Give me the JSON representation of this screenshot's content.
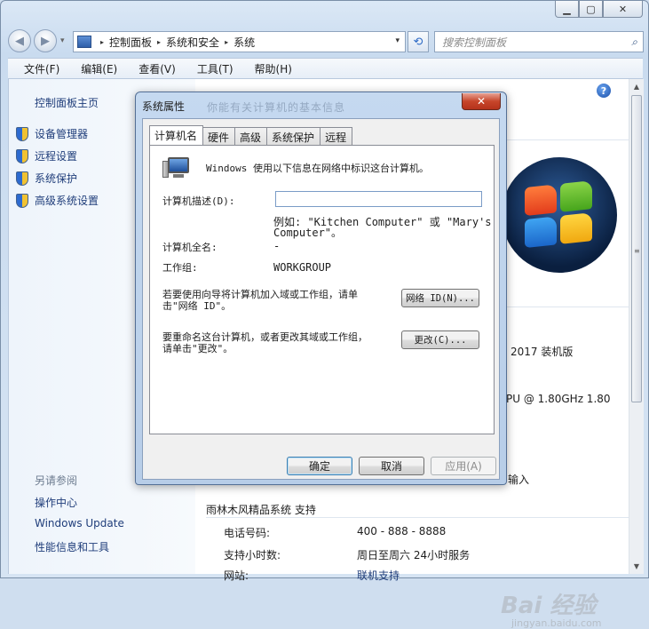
{
  "window": {
    "caption": {
      "minimize": "▁",
      "maximize": "▢",
      "close": "✕"
    }
  },
  "nav": {
    "back": "◀",
    "forward": "▶",
    "dropdown": "▾",
    "breadcrumb": [
      "控制面板",
      "系统和安全",
      "系统"
    ],
    "breadcrumb_sep": "▸",
    "address_dropdown": "▾",
    "refresh": "⟲",
    "search_placeholder": "搜索控制面板",
    "search_icon": "⌕"
  },
  "menubar": [
    "文件(F)",
    "编辑(E)",
    "查看(V)",
    "工具(T)",
    "帮助(H)"
  ],
  "left_pane": {
    "home": "控制面板主页",
    "items": [
      "设备管理器",
      "远程设置",
      "系统保护",
      "高级系统设置"
    ],
    "see_also": "另请参阅",
    "links": [
      "操作中心",
      "Windows Update",
      "性能信息和工具"
    ]
  },
  "right_pane": {
    "help": "?",
    "edition_partial": "2017 装机版",
    "cpu_partial": "PU @ 1.80GHz   1.80",
    "input_partial": "输入",
    "support_heading": "雨林木风精品系统 支持",
    "support_rows": [
      {
        "label": "电话号码:",
        "value": "400 - 888 - 8888"
      },
      {
        "label": "支持小时数:",
        "value": "周日至周六  24小时服务"
      },
      {
        "label": "网站:",
        "value": "联机支持"
      }
    ]
  },
  "scrollbar": {
    "up": "▲",
    "down": "▼",
    "grip": "≡"
  },
  "watermark": {
    "main": "Bai 经验",
    "sub": "jingyan.baidu.com"
  },
  "dialog": {
    "title": "系统属性",
    "ghost_title": "你能有关计算机的基本信息",
    "close": "✕",
    "tabs": [
      "计算机名",
      "硬件",
      "高级",
      "系统保护",
      "远程"
    ],
    "active_tab": 0,
    "intro": "Windows 使用以下信息在网络中标识这台计算机。",
    "desc_label": "计算机描述(D):",
    "desc_value": "",
    "example_line1": "例如: \"Kitchen Computer\" 或 \"Mary's",
    "example_line2": "Computer\"。",
    "fullname_label": "计算机全名:",
    "fullname_value": "-",
    "workgroup_label": "工作组:",
    "workgroup_value": "WORKGROUP",
    "join_text_line1": "若要使用向导将计算机加入域或工作组，请单",
    "join_text_line2": "击\"网络 ID\"。",
    "network_id_button": "网络 ID(N)...",
    "rename_text_line1": "要重命名这台计算机，或者更改其域或工作组，",
    "rename_text_line2": "请单击\"更改\"。",
    "change_button": "更改(C)...",
    "ok_button": "确定",
    "cancel_button": "取消",
    "apply_button": "应用(A)"
  }
}
